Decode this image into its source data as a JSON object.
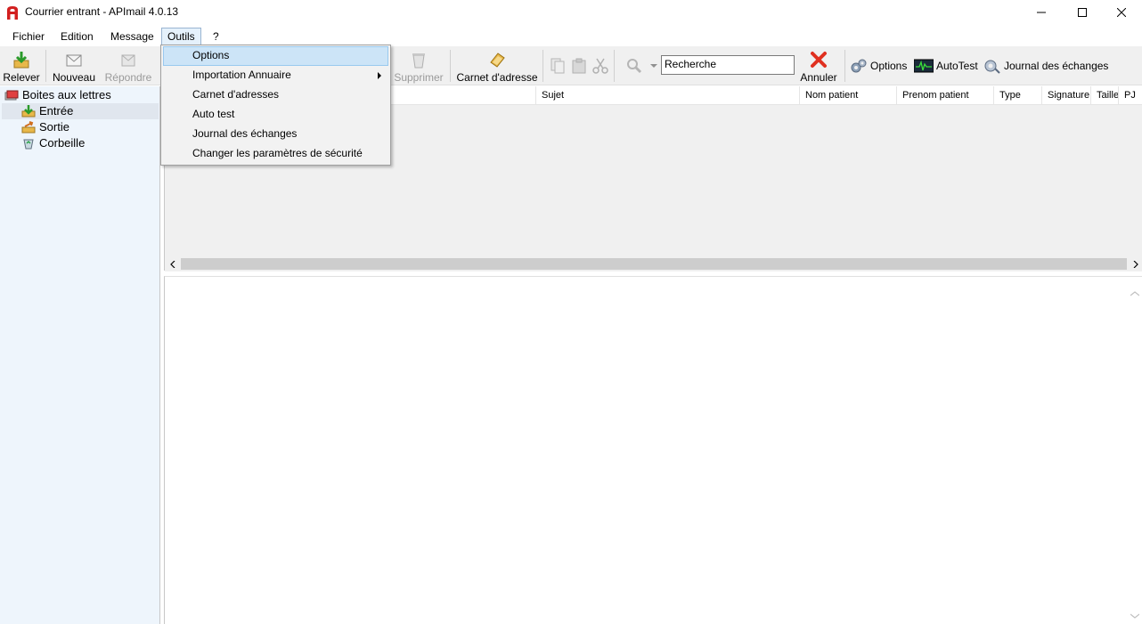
{
  "window": {
    "title": "Courrier entrant - APImail 4.0.13",
    "controls": [
      "minimize",
      "maximize",
      "close"
    ]
  },
  "menubar": {
    "items": [
      "Fichier",
      "Edition",
      "Message",
      "Outils",
      "?"
    ],
    "active": "Outils"
  },
  "toolbar": {
    "releve": "Relever",
    "nouveau": "Nouveau",
    "repondre": "Répondre",
    "supprimer": "Supprimer",
    "carnet": "Carnet d'adresse",
    "annuler": "Annuler",
    "options": "Options",
    "autotest": "AutoTest",
    "journal": "Journal des échanges",
    "search_value": "Recherche"
  },
  "tree": {
    "root": "Boites aux lettres",
    "items": [
      "Entrée",
      "Sortie",
      "Corbeille"
    ],
    "selected": "Entrée"
  },
  "table": {
    "columns": [
      "Sujet",
      "Nom patient",
      "Prenom patient",
      "Type",
      "Signature",
      "Taille",
      "PJ"
    ]
  },
  "dropdown": {
    "items": [
      {
        "label": "Options",
        "highlighted": true,
        "submenu": false
      },
      {
        "label": "Importation Annuaire",
        "highlighted": false,
        "submenu": true
      },
      {
        "label": "Carnet d'adresses",
        "highlighted": false,
        "submenu": false
      },
      {
        "label": "Auto test",
        "highlighted": false,
        "submenu": false
      },
      {
        "label": "Journal des échanges",
        "highlighted": false,
        "submenu": false
      },
      {
        "label": "Changer les paramètres de sécurité",
        "highlighted": false,
        "submenu": false
      }
    ]
  },
  "colors": {
    "accent_red": "#d21f1f",
    "highlight": "#cce4f7",
    "tree_bg": "#eef5fc"
  }
}
